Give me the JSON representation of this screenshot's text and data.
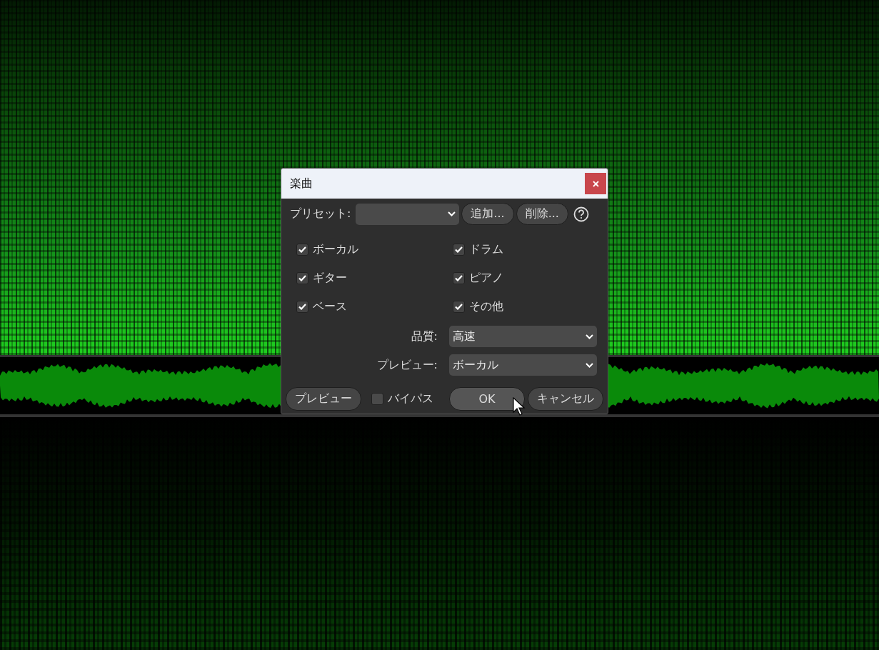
{
  "dialog": {
    "title": "楽曲",
    "preset": {
      "label": "プリセット:",
      "buttons": [
        "追加...",
        "削除..."
      ]
    },
    "stems": [
      {
        "label": "ボーカル",
        "checked": true
      },
      {
        "label": "ドラム",
        "checked": true
      },
      {
        "label": "ギター",
        "checked": true
      },
      {
        "label": "ピアノ",
        "checked": true
      },
      {
        "label": "ベース",
        "checked": true
      },
      {
        "label": "その他",
        "checked": true
      }
    ],
    "fields": [
      {
        "label": "品質:",
        "value": "高速"
      },
      {
        "label": "プレビュー:",
        "value": "ボーカル"
      }
    ],
    "footer": {
      "preview_button": "プレビュー",
      "bypass": {
        "label": "バイパス",
        "checked": false
      },
      "ok_button": "OK",
      "cancel_button": "キャンセル"
    }
  }
}
